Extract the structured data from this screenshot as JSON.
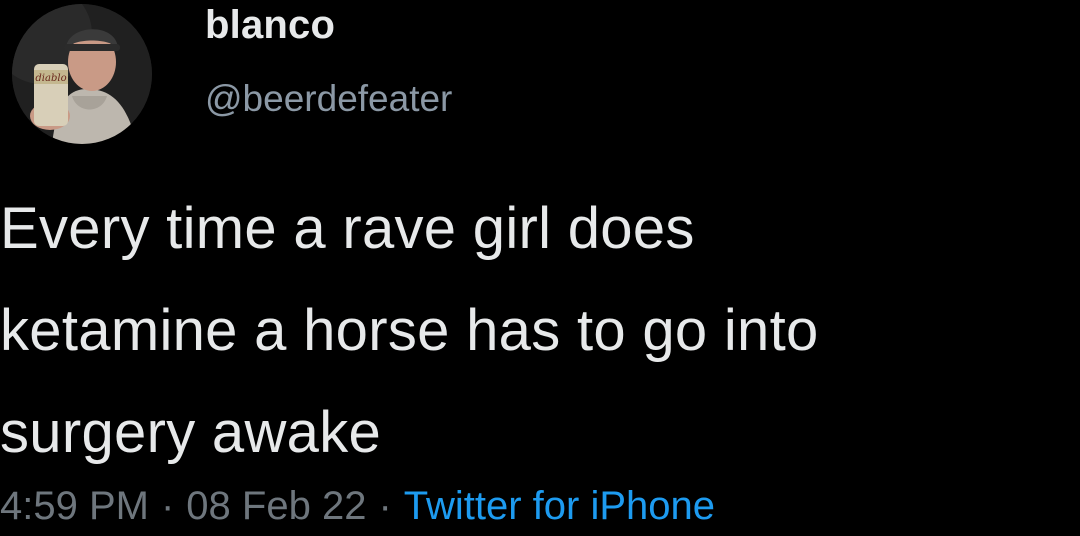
{
  "user": {
    "display_name": "blanco",
    "handle": "@beerdefeater",
    "avatar_icon": "profile-photo"
  },
  "tweet": {
    "lines": [
      "Every time a rave girl does",
      "ketamine a horse has to go into",
      "surgery awake"
    ]
  },
  "meta": {
    "time": "4:59 PM",
    "separator": "·",
    "date": "08 Feb 22",
    "source": "Twitter for iPhone"
  },
  "colors": {
    "background": "#000000",
    "text": "#e7e9ea",
    "secondary": "#8b98a5",
    "link": "#1d9bf0"
  }
}
